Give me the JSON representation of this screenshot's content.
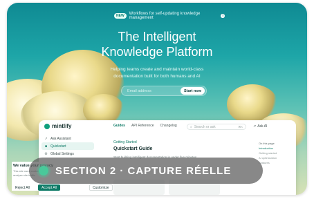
{
  "announcement": {
    "badge": "NEW",
    "text": "Workflows for self-updating knowledge management",
    "icon": "info-icon"
  },
  "hero": {
    "title_line1": "The Intelligent",
    "title_line2": "Knowledge Platform",
    "subtitle": "Helping teams create and maintain world-class documentation built for both humans and AI",
    "email_placeholder": "Email address",
    "cta_label": "Start now"
  },
  "app": {
    "brand": "mintlify",
    "sidebar": [
      {
        "label": "Ask Assistant",
        "icon": "sparkle-icon"
      },
      {
        "label": "Quickstart",
        "icon": "book-icon",
        "active": true
      },
      {
        "label": "Global Settings",
        "icon": "gear-icon"
      }
    ],
    "tabs": [
      "Guides",
      "API Reference",
      "Changelog"
    ],
    "search_placeholder": "Search or ask",
    "search_shortcut": "⌘K",
    "ask_ai": "Ask AI",
    "breadcrumb": "Getting Started",
    "doc_title": "Quickstart Guide",
    "doc_lead": "Start building intelligent documentation in under five minutes",
    "toc": [
      {
        "label": "On this page",
        "kind": "head"
      },
      {
        "label": "Introduction",
        "kind": "active"
      },
      {
        "label": "Getting started",
        "kind": "item"
      },
      {
        "label": "AI optimization",
        "kind": "item"
      },
      {
        "label": "Features",
        "kind": "item"
      }
    ]
  },
  "privacy": {
    "title": "We value your privacy",
    "body_line1": "This site uses cookies to",
    "body_line2": "analyze site traffic",
    "reject": "Reject All",
    "accept": "Accept All",
    "customize": "Customize"
  },
  "overlay": {
    "label": "SECTION 2 · CAPTURE RÉELLE",
    "accent": "#49c99a"
  },
  "colors": {
    "brand": "#0d7a66",
    "hero_top": "#0f8a93"
  }
}
